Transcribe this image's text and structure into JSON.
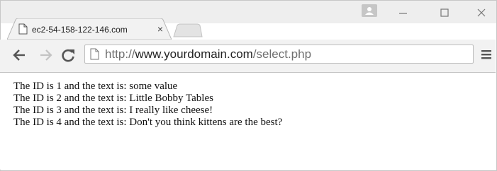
{
  "tab": {
    "title": "ec2-54-158-122-146.com",
    "close_label": "×",
    "page_icon": "page-icon"
  },
  "window_controls": {
    "user_icon": "user-icon",
    "minimize_icon": "minimize-icon",
    "maximize_icon": "maximize-icon",
    "close_icon": "close-icon"
  },
  "toolbar": {
    "back_icon": "back-arrow-icon",
    "forward_icon": "forward-arrow-icon",
    "reload_icon": "reload-icon",
    "menu_icon": "hamburger-menu-icon"
  },
  "address_bar": {
    "scheme": "http://",
    "host": "www.yourdomain.com",
    "path": "/select.php"
  },
  "page": {
    "lines": [
      "The ID is 1 and the text is: some value",
      "The ID is 2 and the text is: Little Bobby Tables",
      "The ID is 3 and the text is: I really like cheese!",
      "The ID is 4 and the text is: Don't you think kittens are the best?"
    ]
  },
  "colors": {
    "chrome_background": "#eeeeee",
    "toolbar_background": "#f2f2f2",
    "url_muted": "#6f6f6f",
    "url_host": "#222222"
  }
}
